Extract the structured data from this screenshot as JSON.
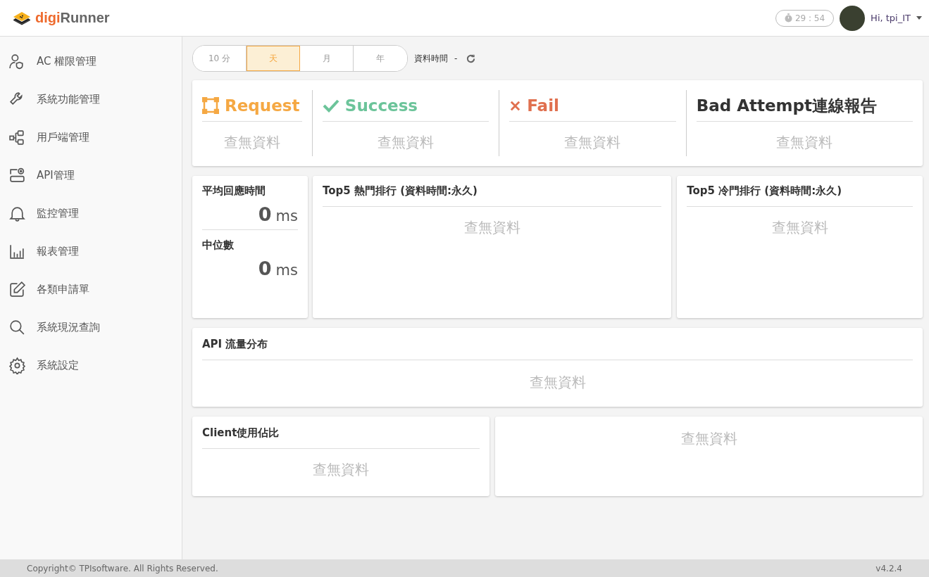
{
  "header": {
    "logo": {
      "part_1": "digi",
      "part_2": "Runner"
    },
    "timer": "29 : 54",
    "user": "Hi, tpi_IT"
  },
  "sidebar": {
    "items": [
      {
        "label": "AC 權限管理"
      },
      {
        "label": "系統功能管理"
      },
      {
        "label": "用戶端管理"
      },
      {
        "label": "API管理"
      },
      {
        "label": "監控管理"
      },
      {
        "label": "報表管理"
      },
      {
        "label": "各類申請單"
      },
      {
        "label": "系統現況查詢"
      },
      {
        "label": "系統設定"
      }
    ]
  },
  "range_tabs": [
    {
      "label": "10 分",
      "selected": false
    },
    {
      "label": "天",
      "selected": true
    },
    {
      "label": "月",
      "selected": false
    },
    {
      "label": "年",
      "selected": false
    }
  ],
  "data_time": {
    "label": "資料時間",
    "value": "-"
  },
  "stat_cards": [
    {
      "kind": "request",
      "title": "Request",
      "empty": "查無資料"
    },
    {
      "kind": "success",
      "title": "Success",
      "empty": "查無資料"
    },
    {
      "kind": "fail",
      "title": "Fail",
      "empty": "查無資料"
    },
    {
      "kind": "bad",
      "title": "Bad Attempt連線報告",
      "empty": "查無資料"
    }
  ],
  "latency": [
    {
      "label": "平均回應時間",
      "value": "0",
      "unit": "ms"
    },
    {
      "label": "中位數",
      "value": "0",
      "unit": "ms"
    }
  ],
  "rankings": [
    {
      "title": "Top5 熱門排行 (資料時間:永久)",
      "empty": "查無資料"
    },
    {
      "title": "Top5 冷門排行 (資料時間:永久)",
      "empty": "查無資料"
    }
  ],
  "api_flow": {
    "title": "API 流量分布",
    "empty": "查無資料"
  },
  "client_usage": {
    "title": "Client使用佔比",
    "empty": "查無資料"
  },
  "client_chart": {
    "empty": "查無資料"
  },
  "footer": {
    "copyright": "Copyright© TPIsoftware. All Rights Reserved.",
    "version": "v4.2.4"
  }
}
